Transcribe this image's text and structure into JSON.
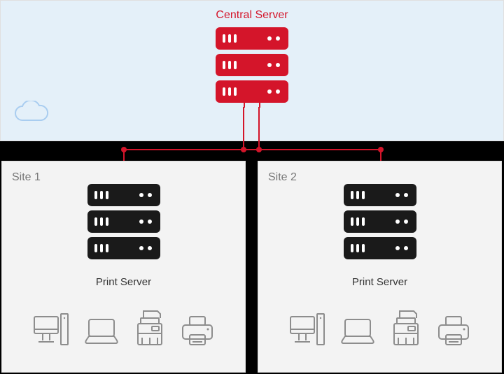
{
  "colors": {
    "accent": "#d4152a",
    "cloud_bg": "#e4f0f9",
    "panel_bg": "#f3f3f3"
  },
  "central": {
    "title": "Central Server"
  },
  "sites": [
    {
      "label": "Site 1",
      "server_label": "Print Server"
    },
    {
      "label": "Site 2",
      "server_label": "Print Server"
    }
  ],
  "device_icons": [
    "desktop-icon",
    "laptop-icon",
    "copier-icon",
    "printer-icon"
  ]
}
